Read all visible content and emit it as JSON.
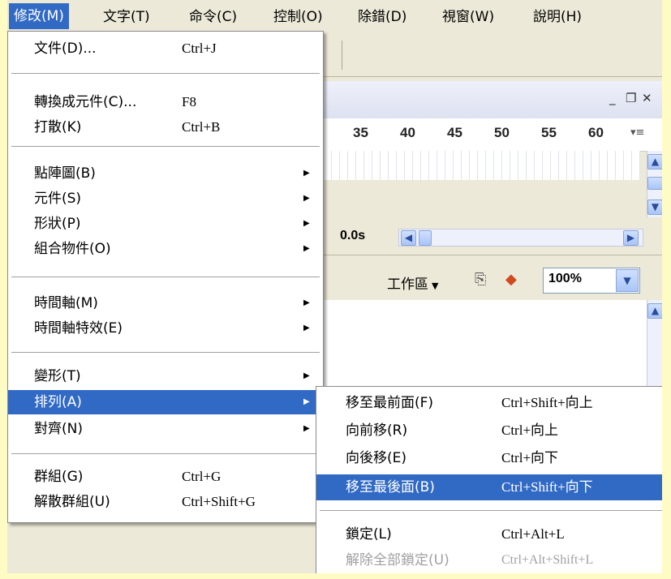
{
  "menubar": {
    "items": [
      {
        "label": "修改(M)"
      },
      {
        "label": "文字(T)"
      },
      {
        "label": "命令(C)"
      },
      {
        "label": "控制(O)"
      },
      {
        "label": "除錯(D)"
      },
      {
        "label": "視窗(W)"
      },
      {
        "label": "說明(H)"
      }
    ]
  },
  "timeline": {
    "ruler": [
      "35",
      "40",
      "45",
      "50",
      "55",
      "60"
    ],
    "time": "0.0s"
  },
  "toolbar": {
    "workspace_label": "工作區",
    "zoom": "100%"
  },
  "modify_menu": {
    "items": [
      {
        "label": "文件(D)...",
        "shortcut": "Ctrl+J"
      },
      {
        "label": "轉換成元件(C)...",
        "shortcut": "F8"
      },
      {
        "label": "打散(K)",
        "shortcut": "Ctrl+B"
      },
      {
        "label": "點陣圖(B)",
        "shortcut": ""
      },
      {
        "label": "元件(S)",
        "shortcut": ""
      },
      {
        "label": "形狀(P)",
        "shortcut": ""
      },
      {
        "label": "組合物件(O)",
        "shortcut": ""
      },
      {
        "label": "時間軸(M)",
        "shortcut": ""
      },
      {
        "label": "時間軸特效(E)",
        "shortcut": ""
      },
      {
        "label": "變形(T)",
        "shortcut": ""
      },
      {
        "label": "排列(A)",
        "shortcut": ""
      },
      {
        "label": "對齊(N)",
        "shortcut": ""
      },
      {
        "label": "群組(G)",
        "shortcut": "Ctrl+G"
      },
      {
        "label": "解散群組(U)",
        "shortcut": "Ctrl+Shift+G"
      }
    ]
  },
  "arrange_submenu": {
    "items": [
      {
        "label": "移至最前面(F)",
        "shortcut": "Ctrl+Shift+向上"
      },
      {
        "label": "向前移(R)",
        "shortcut": "Ctrl+向上"
      },
      {
        "label": "向後移(E)",
        "shortcut": "Ctrl+向下"
      },
      {
        "label": "移至最後面(B)",
        "shortcut": "Ctrl+Shift+向下"
      },
      {
        "label": "鎖定(L)",
        "shortcut": "Ctrl+Alt+L"
      },
      {
        "label": "解除全部鎖定(U)",
        "shortcut": "Ctrl+Alt+Shift+L"
      }
    ]
  },
  "colors": {
    "highlight": "#316ac5",
    "page_background": "#fffbc4",
    "chrome": "#ece9d8"
  },
  "icons": [
    "submenu-arrow-icon",
    "minimize-icon",
    "restore-icon",
    "close-icon",
    "scroll-up-icon",
    "scroll-down-icon",
    "scroll-left-icon",
    "scroll-right-icon",
    "edit-scene-icon",
    "edit-symbol-icon",
    "dropdown-arrow-icon"
  ]
}
